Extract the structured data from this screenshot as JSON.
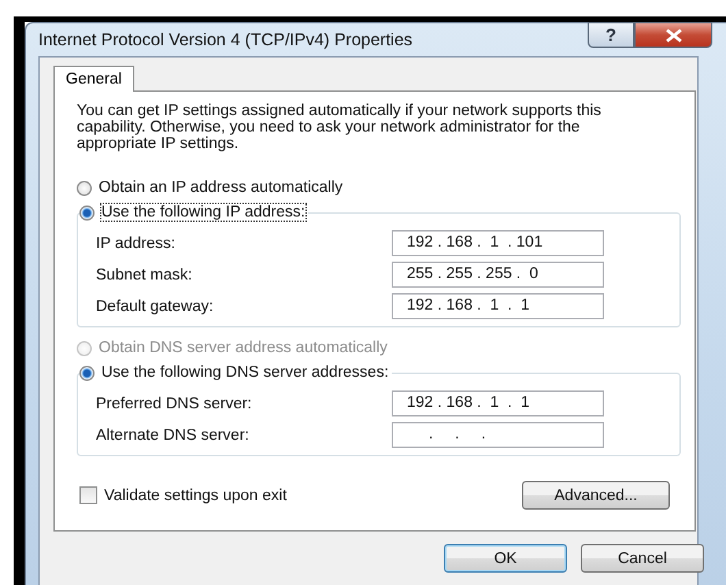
{
  "window": {
    "title": "Internet Protocol Version 4 (TCP/IPv4) Properties",
    "help_button": "?"
  },
  "tabs": [
    {
      "label": "General",
      "selected": true
    }
  ],
  "description": "You can get IP settings assigned automatically if your network supports this capability. Otherwise, you need to ask your network administrator for the appropriate IP settings.",
  "ip_section": {
    "options": [
      {
        "label": "Obtain an IP address automatically",
        "selected": false,
        "disabled": false
      },
      {
        "label": "Use the following IP address:",
        "selected": true,
        "disabled": false
      }
    ],
    "fields": [
      {
        "label": "IP address:",
        "value": "192 . 168 .  1  . 101"
      },
      {
        "label": "Subnet mask:",
        "value": "255 . 255 . 255 .  0"
      },
      {
        "label": "Default gateway:",
        "value": "192 . 168 .  1  .  1"
      }
    ]
  },
  "dns_section": {
    "options": [
      {
        "label": "Obtain DNS server address automatically",
        "selected": false,
        "disabled": true
      },
      {
        "label": "Use the following DNS server addresses:",
        "selected": true,
        "disabled": false
      }
    ],
    "fields": [
      {
        "label": "Preferred DNS server:",
        "value": "192 . 168 .  1  .  1"
      },
      {
        "label": "Alternate DNS server:",
        "value": "     .     .     ."
      }
    ]
  },
  "validate_checkbox": {
    "label": "Validate settings upon exit",
    "checked": false
  },
  "buttons": {
    "advanced": "Advanced...",
    "ok": "OK",
    "cancel": "Cancel"
  }
}
